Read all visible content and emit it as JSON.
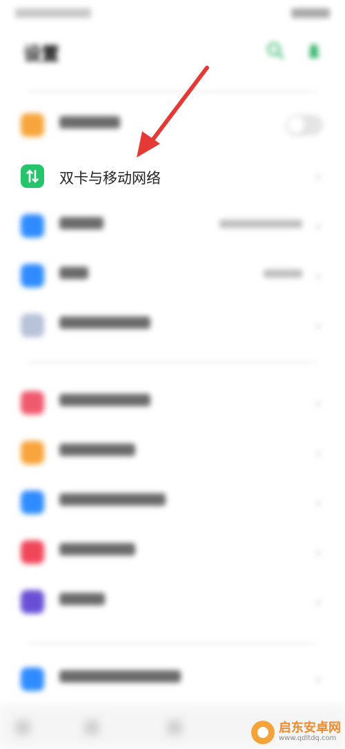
{
  "header": {
    "title": "设置"
  },
  "rows": [
    {
      "label": "飞行模式",
      "icon_color": "#f7a53c",
      "icon": "airplane-icon",
      "has_toggle": true
    },
    {
      "label": "双卡与移动网络",
      "icon_color": "#27c56b",
      "icon": "dual-sim-icon",
      "highlighted": true
    },
    {
      "label": "WLAN",
      "value": "TP-LINK_6750",
      "icon_color": "#2f8cff",
      "icon": "wifi-icon"
    },
    {
      "label": "蓝牙",
      "value": "已开启",
      "icon_color": "#2f8cff",
      "icon": "bluetooth-icon"
    },
    {
      "label": "其他无线连接",
      "icon_color": "#b8c2d8",
      "icon": "wireless-icon"
    },
    {
      "label": "通知与状态栏",
      "icon_color": "#f05a6e",
      "icon": "notification-icon"
    },
    {
      "label": "显示与亮度",
      "icon_color": "#f7a53c",
      "icon": "display-icon"
    },
    {
      "label": "桌面与锁屏杂志",
      "icon_color": "#2f8cff",
      "icon": "desktop-icon"
    },
    {
      "label": "声音与振动",
      "icon_color": "#f0485a",
      "icon": "sound-icon"
    },
    {
      "label": "免打扰",
      "icon_color": "#6a4fd6",
      "icon": "dnd-icon"
    },
    {
      "label": "指纹、面部与密码",
      "icon_color": "#2f8cff",
      "icon": "fingerprint-icon"
    }
  ],
  "watermark": {
    "name": "启东安卓网",
    "url": "www.qdltdq.com"
  },
  "colors": {
    "arrow": "#e53935"
  }
}
